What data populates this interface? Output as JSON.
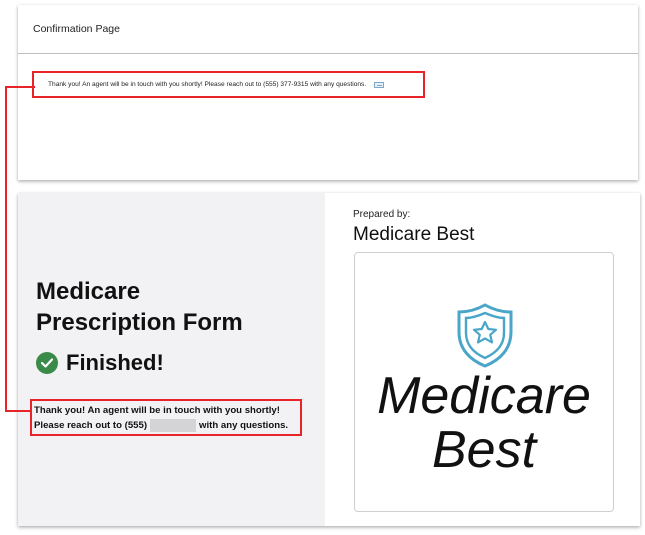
{
  "top_card": {
    "title": "Confirmation Page",
    "message": "Thank you! An agent will be in touch with you shortly! Please reach out to (555) 377-9315 with any questions."
  },
  "form": {
    "title_line1": "Medicare",
    "title_line2": "Prescription Form",
    "status": "Finished!",
    "message_line1": "Thank you! An agent will be in touch with you shortly!",
    "message_line2_start": "Please reach out to (555)",
    "message_line2_end": "with any questions."
  },
  "prepared": {
    "label": "Prepared by:",
    "company": "Medicare Best",
    "logo_line1": "Medicare",
    "logo_line2": "Best"
  },
  "colors": {
    "highlight": "#e8232a",
    "check": "#3a8a4a",
    "shield": "#4aa6c9"
  }
}
